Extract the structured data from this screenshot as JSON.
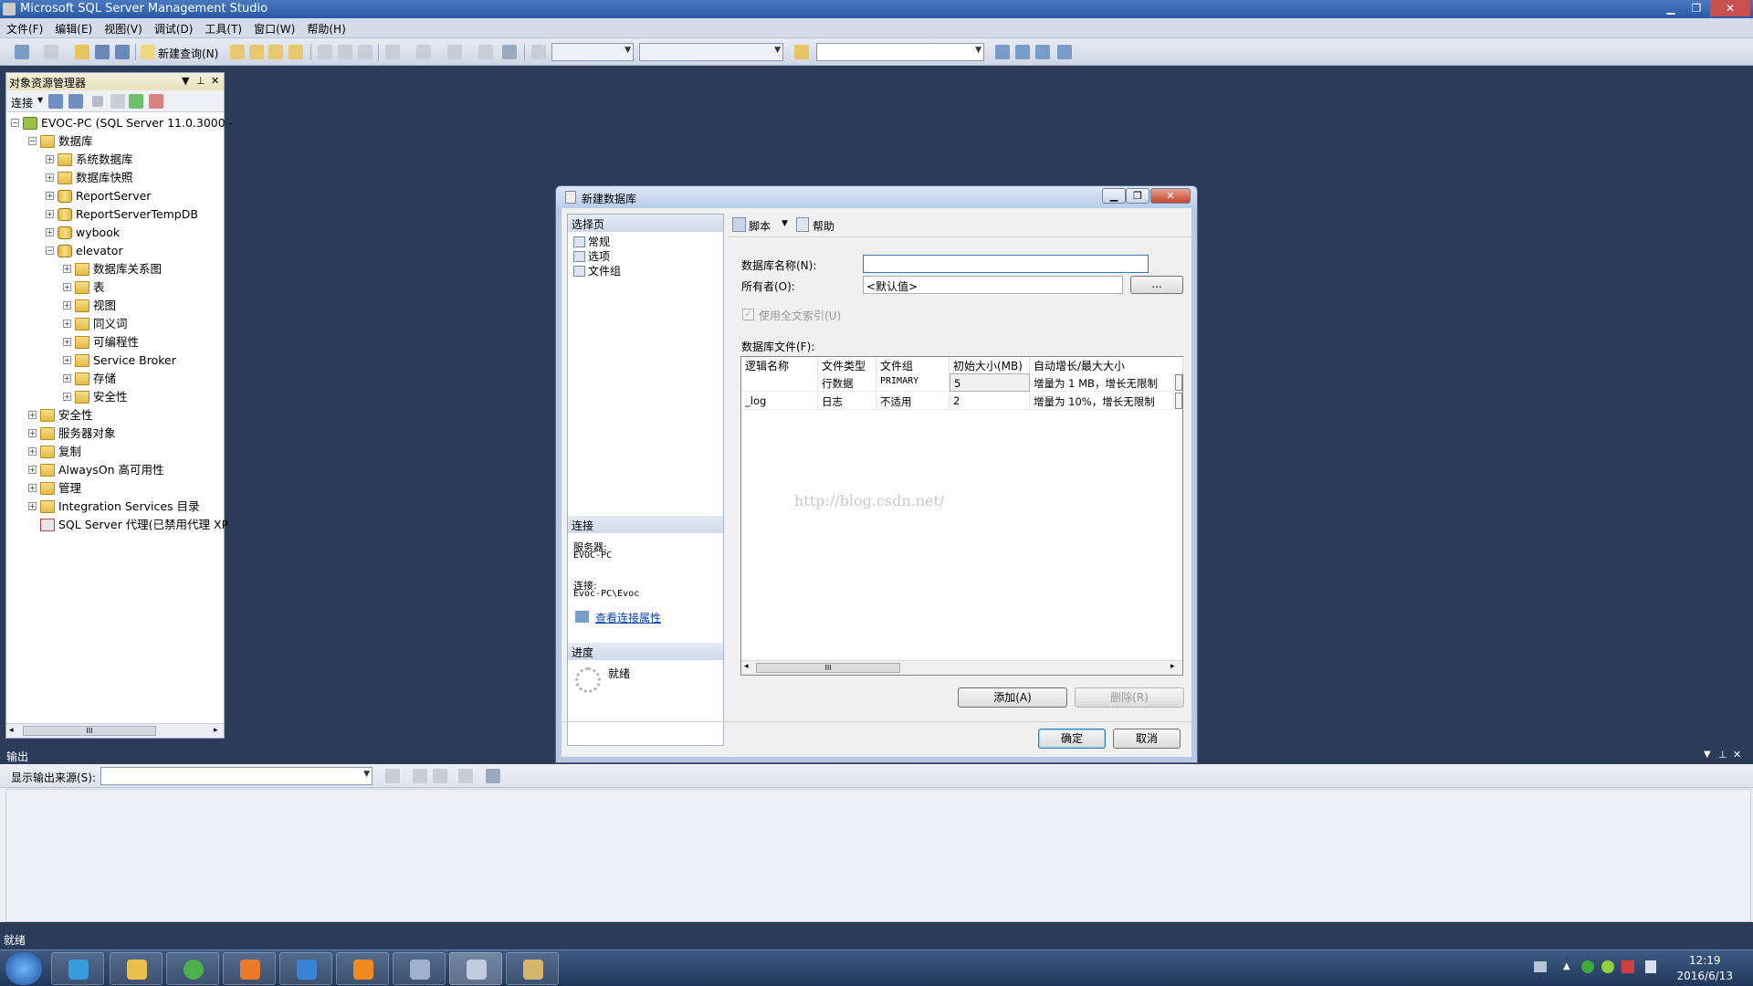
{
  "app": {
    "title": "Microsoft SQL Server Management Studio"
  },
  "window_controls": {
    "minimize": "▁",
    "restore": "❐",
    "close": "✕"
  },
  "menu": [
    "文件(F)",
    "编辑(E)",
    "视图(V)",
    "调试(D)",
    "工具(T)",
    "窗口(W)",
    "帮助(H)"
  ],
  "toolbar": {
    "new_query": "新建查询(N)"
  },
  "object_explorer": {
    "title": "对象资源管理器",
    "connect_label": "连接",
    "tree": [
      {
        "label": "EVOC-PC (SQL Server 11.0.3000 -",
        "exp": "−",
        "icon": "server-icon"
      },
      {
        "label": "数据库",
        "exp": "−",
        "icon": "folder-icon"
      },
      {
        "label": "系统数据库",
        "exp": "+",
        "icon": "folder-icon"
      },
      {
        "label": "数据库快照",
        "exp": "+",
        "icon": "folder-icon"
      },
      {
        "label": "ReportServer",
        "exp": "+",
        "icon": "database-icon"
      },
      {
        "label": "ReportServerTempDB",
        "exp": "+",
        "icon": "database-icon"
      },
      {
        "label": "wybook",
        "exp": "+",
        "icon": "database-icon"
      },
      {
        "label": "elevator",
        "exp": "−",
        "icon": "database-icon"
      },
      {
        "label": "数据库关系图",
        "exp": "+",
        "icon": "folder-icon"
      },
      {
        "label": "表",
        "exp": "+",
        "icon": "folder-icon"
      },
      {
        "label": "视图",
        "exp": "+",
        "icon": "folder-icon"
      },
      {
        "label": "同义词",
        "exp": "+",
        "icon": "folder-icon"
      },
      {
        "label": "可编程性",
        "exp": "+",
        "icon": "folder-icon"
      },
      {
        "label": "Service Broker",
        "exp": "+",
        "icon": "folder-icon"
      },
      {
        "label": "存储",
        "exp": "+",
        "icon": "folder-icon"
      },
      {
        "label": "安全性",
        "exp": "+",
        "icon": "folder-icon"
      },
      {
        "label": "安全性",
        "exp": "+",
        "icon": "folder-icon"
      },
      {
        "label": "服务器对象",
        "exp": "+",
        "icon": "folder-icon"
      },
      {
        "label": "复制",
        "exp": "+",
        "icon": "folder-icon"
      },
      {
        "label": "AlwaysOn 高可用性",
        "exp": "+",
        "icon": "folder-icon"
      },
      {
        "label": "管理",
        "exp": "+",
        "icon": "folder-icon"
      },
      {
        "label": "Integration Services 目录",
        "exp": "+",
        "icon": "folder-icon"
      },
      {
        "label": "SQL Server 代理(已禁用代理 XP",
        "exp": "",
        "icon": "agent-icon"
      }
    ],
    "scroll_grip": "III"
  },
  "output": {
    "title": "输出",
    "source_label": "显示输出来源(S):",
    "source_value": ""
  },
  "status": {
    "text": "就绪"
  },
  "taskbar": {
    "time": "12:19",
    "date": "2016/6/13"
  },
  "dialog": {
    "title": "新建数据库",
    "select_page": "选择页",
    "pages": [
      "常规",
      "选项",
      "文件组"
    ],
    "connection_header": "连接",
    "server_label": "服务器:",
    "server_value": "EVOC-PC",
    "connection_label": "连接:",
    "connection_value": "Evoc-PC\\Evoc",
    "view_conn_props": "查看连接属性",
    "progress_header": "进度",
    "progress_status": "就绪",
    "script_button": "脚本",
    "help_button": "帮助",
    "db_name_label": "数据库名称(N):",
    "db_name_value": "",
    "owner_label": "所有者(O):",
    "owner_value": "<默认值>",
    "owner_browse": "...",
    "fulltext_label": "使用全文索引(U)",
    "files_label": "数据库文件(F):",
    "columns": [
      "逻辑名称",
      "文件类型",
      "文件组",
      "初始大小(MB)",
      "自动增长/最大大小"
    ],
    "rows": [
      {
        "logical": "",
        "type": "行数据",
        "group": "PRIMARY",
        "size": "5",
        "growth": "增量为 1 MB，增长无限制"
      },
      {
        "logical": "_log",
        "type": "日志",
        "group": "不适用",
        "size": "2",
        "growth": "增量为 10%，增长无限制"
      }
    ],
    "watermark": "http://blog.csdn.net/",
    "scroll_grip": "III",
    "add_button": "添加(A)",
    "remove_button": "删除(R)",
    "ok_button": "确定",
    "cancel_button": "取消"
  }
}
